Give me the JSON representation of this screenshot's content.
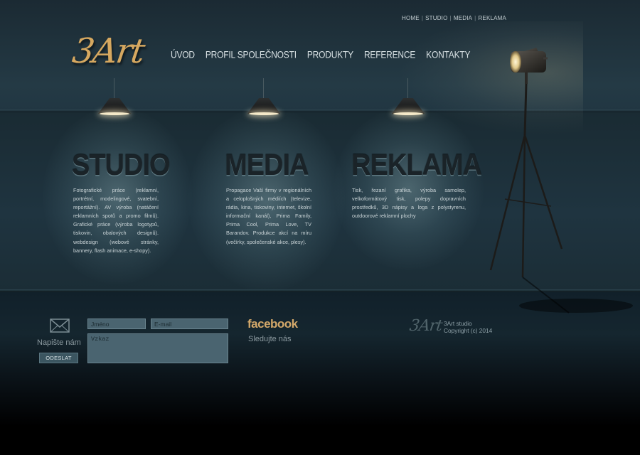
{
  "top_links": [
    "HOME",
    "STUDIO",
    "MEDIA",
    "REKLAMA"
  ],
  "logo": {
    "text": "3Art"
  },
  "nav": [
    "ÚVOD",
    "PROFIL SPOLEČNOSTI",
    "PRODUKTY",
    "REFERENCE",
    "KONTAKTY"
  ],
  "sections": [
    {
      "title": "STUDIO",
      "text": "Fotografické práce (reklamní, portrétní, modelingové, svatební, reportážní). AV výroba (natáčení reklamních spotů a promo filmů). Grafické práce (výroba logotypů, tiskovin, obalových designů). webdesign (webové stránky, bannery, flash animace, e-shopy)."
    },
    {
      "title": "MEDIA",
      "text": "Propagace Vaší firmy v regionálních a celoplošných médiích (televize, rádia, kina, tiskoviny, internet, školní informační kanál), Prima Family, Prima Cool, Prima Love, TV Barandov. Produkce akcí na míru (večírky, společenské akce, plesy)."
    },
    {
      "title": "REKLAMA",
      "text": "Tisk, řezaní grafika, výroba samolep, velkoformátový tisk, polepy dopravních prostředků, 3D nápisy a loga z polystyrenu, outdoorové reklamní plochy"
    }
  ],
  "footer": {
    "contact_label": "Napište nám",
    "send_button": "ODESLAT",
    "name_placeholder": "Jméno",
    "email_placeholder": "E-mail",
    "message_placeholder": "Vzkaz",
    "facebook_logo": "facebook",
    "facebook_follow": "Sledujte nás",
    "footer_logo": "3Art",
    "studio_name": "3Art studio",
    "copyright": "Copyright (c) 2014"
  }
}
